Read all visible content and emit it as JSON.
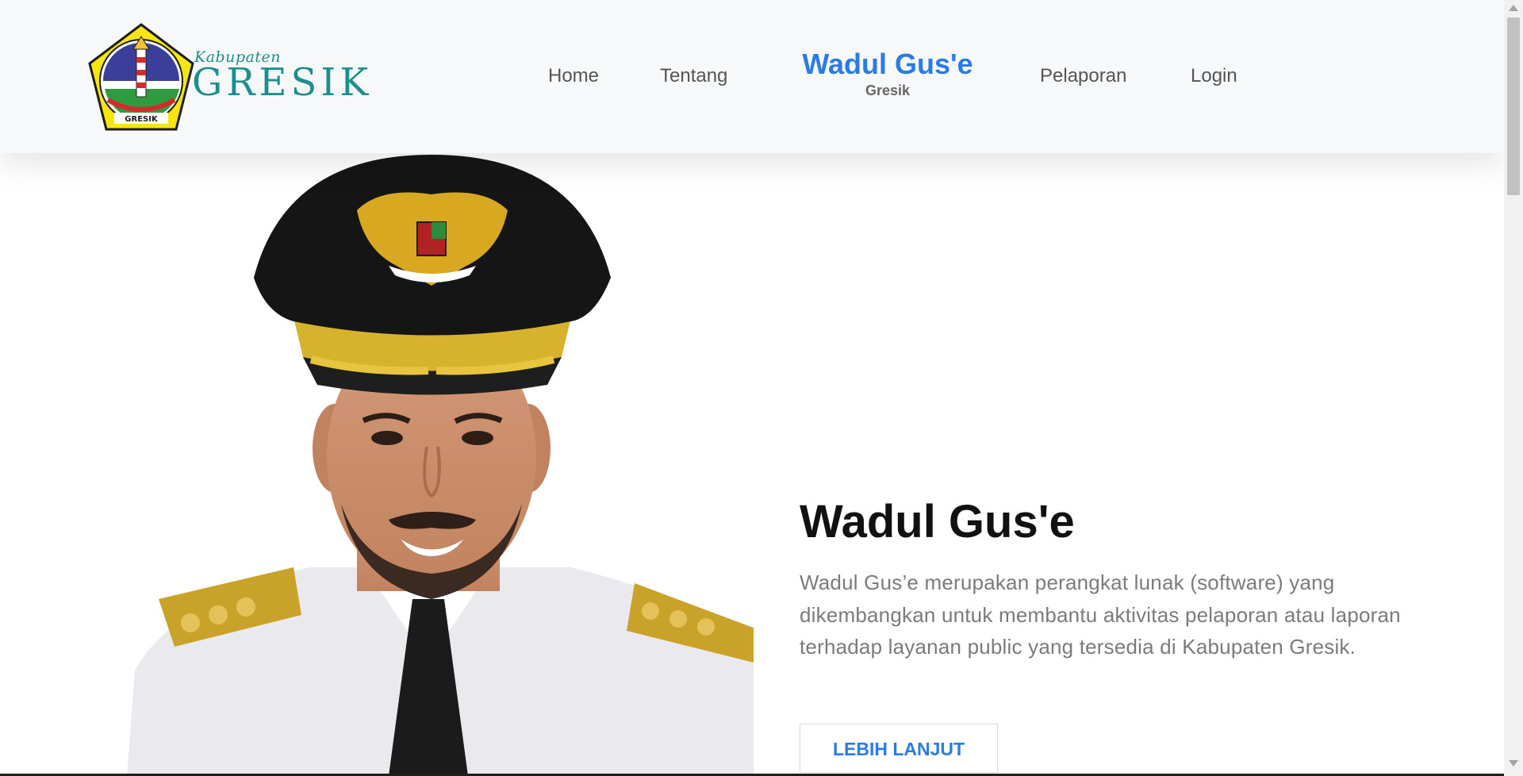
{
  "navbar": {
    "logo": {
      "small_text": "Kabupaten",
      "big_text": "GRESIK",
      "emblem_text": "GRESIK"
    },
    "links": {
      "home": "Home",
      "tentang": "Tentang",
      "pelaporan": "Pelaporan",
      "login": "Login"
    },
    "brand": {
      "title": "Wadul Gus'e",
      "subtitle": "Gresik"
    }
  },
  "hero": {
    "title": "Wadul Gus'e",
    "description": "Wadul Gus’e merupakan perangkat lunak (software) yang dikembangkan untuk membantu aktivitas pelaporan atau laporan terhadap layanan public yang tersedia di Kabupaten Gresik.",
    "button_label": "LEBIH LANJUT"
  },
  "colors": {
    "accent": "#2a7be4",
    "logo_teal": "#1c8f8c",
    "navbar_bg": "#f7f8f9",
    "emblem_yellow": "#f5e60f"
  }
}
